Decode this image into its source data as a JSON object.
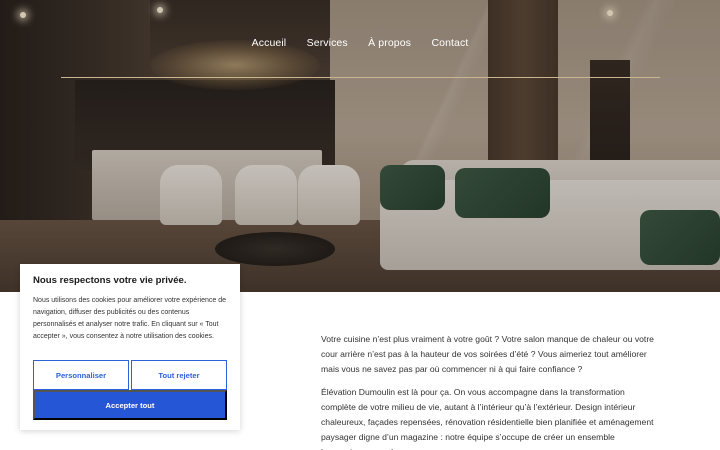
{
  "nav": {
    "items": [
      "Accueil",
      "Services",
      "À propos",
      "Contact"
    ]
  },
  "content": {
    "paragraph_1": "Votre cuisine n’est plus vraiment à votre goût ? Votre salon manque de chaleur ou votre cour arrière n’est pas à la hauteur de vos soirées d’été ? Vous aimeriez tout améliorer mais vous ne savez pas par où commencer ni à qui faire confiance ?",
    "paragraph_2": "Élévation Dumoulin est là pour ça. On vous accompagne dans la transformation complète de votre milieu de vie, autant à l’intérieur qu’à l’extérieur. Design intérieur chaleureux, façades repensées, rénovation résidentielle bien planifiée et aménagement paysager digne d’un magazine : notre équipe s’occupe de créer un ensemble harmonieux, pensé"
  },
  "cookie": {
    "title": "Nous respectons votre vie privée.",
    "message": "Nous utilisons des cookies pour améliorer votre expérience de navigation, diffuser des publicités ou des contenus personnalisés et analyser notre trafic. En cliquant sur « Tout accepter », vous consentez à notre utilisation des cookies.",
    "customize_label": "Personnaliser",
    "reject_label": "Tout rejeter",
    "accept_label": "Accepter tout"
  },
  "colors": {
    "accent": "#2456d6",
    "nav_rule": "#c9b68f"
  }
}
